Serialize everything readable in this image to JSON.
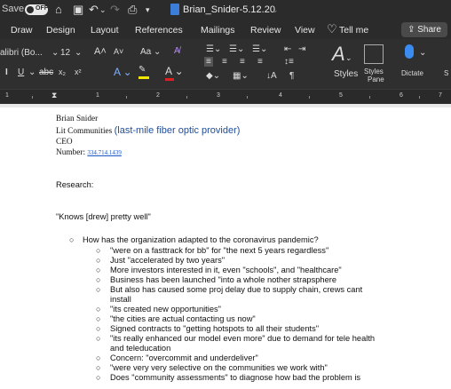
{
  "titlebar": {
    "autosave_label": "Save",
    "toggle_state": "OFF",
    "doc_title": "Brian_Snider-5.12.20"
  },
  "tabs": [
    "Draw",
    "Design",
    "Layout",
    "References",
    "Mailings",
    "Review",
    "View"
  ],
  "tell_me": "Tell me",
  "share_label": "Share",
  "ribbon": {
    "font_name": "alibri (Bo...",
    "font_size": "12",
    "styles_label": "Styles",
    "styles_pane_label_1": "Styles",
    "styles_pane_label_2": "Pane",
    "dictate_label": "Dictate"
  },
  "ruler_numbers": [
    "1",
    "2",
    "3",
    "4",
    "5",
    "6",
    "7"
  ],
  "document": {
    "name": "Brian Snider",
    "company": "Lit Communities ",
    "company_note": "(last-mile fiber optic provider)",
    "role": "CEO",
    "number_label": "Number: ",
    "number_value": "334.714.1439",
    "research": "Research:",
    "quote": "\"Knows [drew] pretty well\"",
    "question": "How has the organization adapted to the coronavirus pandemic?",
    "bullets": [
      "\"were on a fasttrack for bb\" for \"the next 5 years regardless\"",
      "Just \"accelerated by two years\"",
      "More investors interested in it, even \"schools\", and \"healthcare\"",
      "Business has been launched \"into a whole nother strapsphere",
      "But also has caused some proj delay due to supply chain, crews cant",
      "install",
      "\"its created new opportunities\"",
      "\"the cities are actual contacting us now\"",
      "Signed contracts to \"getting hotspots to all their students\"",
      "\"its really enhanced our model even more\" due to demand for tele health",
      "and teleducation",
      "Concern: \"overcommit and underdeliver\"",
      "\"were very very selective on the communities we work with\"",
      "Does \"community assessments\" to diagnose how bad the problem is"
    ]
  }
}
